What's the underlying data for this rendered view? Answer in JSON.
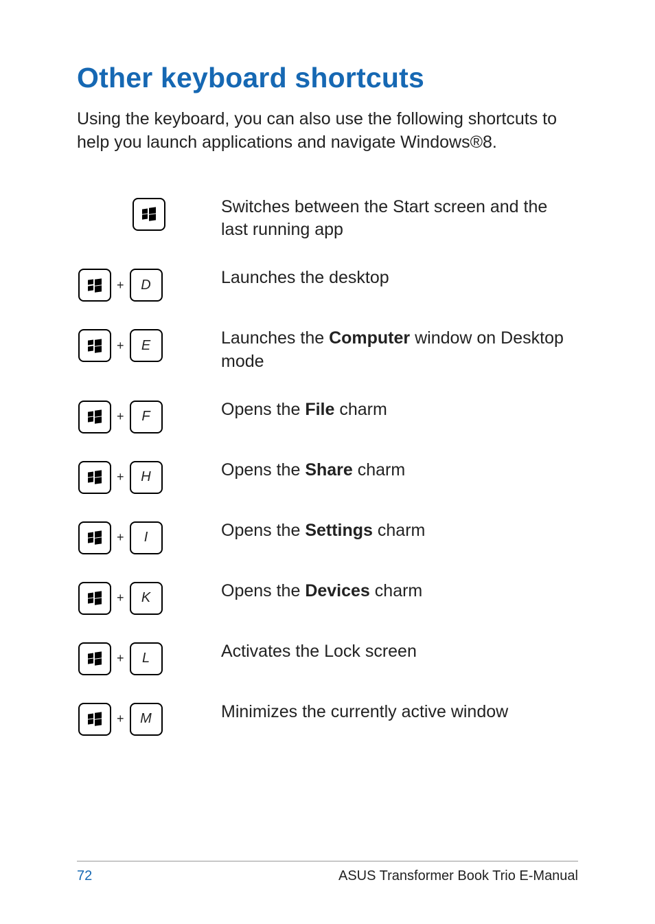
{
  "title": "Other keyboard shortcuts",
  "intro": "Using the keyboard, you can also use the following shortcuts to help you launch applications and navigate Windows®8.",
  "rows": [
    {
      "key2": "",
      "desc_html": "Switches between the Start screen and the last running app"
    },
    {
      "key2": "D",
      "desc_html": "Launches the desktop"
    },
    {
      "key2": "E",
      "desc_html": "Launches the <b>Computer</b> window on Desktop mode"
    },
    {
      "key2": "F",
      "desc_html": "Opens the <b>File</b> charm"
    },
    {
      "key2": "H",
      "desc_html": "Opens the <b>Share</b> charm"
    },
    {
      "key2": "I",
      "desc_html": "Opens the <b>Settings</b> charm"
    },
    {
      "key2": "K",
      "desc_html": "Opens the <b>Devices</b> charm"
    },
    {
      "key2": "L",
      "desc_html": "Activates the Lock screen"
    },
    {
      "key2": "M",
      "desc_html": "Minimizes the currently active window"
    }
  ],
  "footer": {
    "page": "72",
    "book": "ASUS Transformer Book Trio E-Manual"
  }
}
